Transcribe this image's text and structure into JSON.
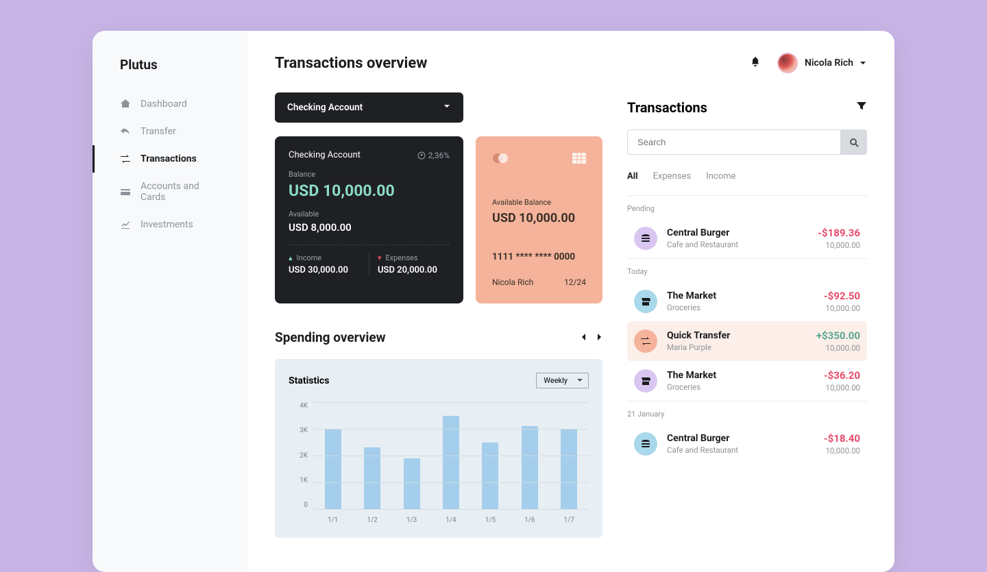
{
  "brand": "Plutus",
  "nav": {
    "dashboard": "Dashboard",
    "transfer": "Transfer",
    "transactions": "Transactions",
    "accounts": "Accounts and Cards",
    "investments": "Investments"
  },
  "header": {
    "title": "Transactions overview",
    "user": "Nicola Rich"
  },
  "account_selector": "Checking Account",
  "account": {
    "name": "Checking Account",
    "pct": "2,36%",
    "balance_label": "Balance",
    "balance": "USD 10,000.00",
    "available_label": "Available",
    "available": "USD 8,000.00",
    "income_label": "Income",
    "income": "USD 30,000.00",
    "expenses_label": "Expenses",
    "expenses": "USD 20,000.00"
  },
  "card": {
    "avail_label": "Available Balance",
    "avail": "USD 10,000.00",
    "number": "1111 **** **** 0000",
    "holder": "Nicola Rich",
    "expiry": "12/24"
  },
  "spending": {
    "title": "Spending overview",
    "stats_title": "Statistics",
    "period": "Weekly"
  },
  "chart_data": {
    "type": "bar",
    "categories": [
      "1/1",
      "1/2",
      "1/3",
      "1/4",
      "1/5",
      "1/6",
      "1/7"
    ],
    "values": [
      3000,
      2300,
      1900,
      3500,
      2500,
      3100,
      3000
    ],
    "ylabels": [
      "4K",
      "3K",
      "2K",
      "1K",
      "0"
    ],
    "ylim": [
      0,
      4000
    ]
  },
  "trans_panel": {
    "title": "Transactions",
    "search_placeholder": "Search",
    "tabs": {
      "all": "All",
      "expenses": "Expenses",
      "income": "Income"
    },
    "groups": {
      "pending": "Pending",
      "today": "Today",
      "jan21": "21 January"
    },
    "items": {
      "centralburger1": {
        "title": "Central Burger",
        "sub": "Cafe and Restaurant",
        "amt": "-$189.36",
        "bal": "10,000.00",
        "iconbg": "#d9c7f2",
        "icon": "burger"
      },
      "market1": {
        "title": "The Market",
        "sub": "Groceries",
        "amt": "-$92.50",
        "bal": "10,000.00",
        "iconbg": "#a8d8ea",
        "icon": "store"
      },
      "quicktransfer": {
        "title": "Quick Transfer",
        "sub": "Maria Purple",
        "amt": "+$350.00",
        "bal": "10,000.00",
        "iconbg": "#f4b39a",
        "icon": "transfer"
      },
      "market2": {
        "title": "The Market",
        "sub": "Groceries",
        "amt": "-$36.20",
        "bal": "10,000.00",
        "iconbg": "#d9c7f2",
        "icon": "store"
      },
      "centralburger2": {
        "title": "Central Burger",
        "sub": "Cafe and Restaurant",
        "amt": "-$18.40",
        "bal": "10,000.00",
        "iconbg": "#a8d8ea",
        "icon": "burger"
      }
    }
  }
}
